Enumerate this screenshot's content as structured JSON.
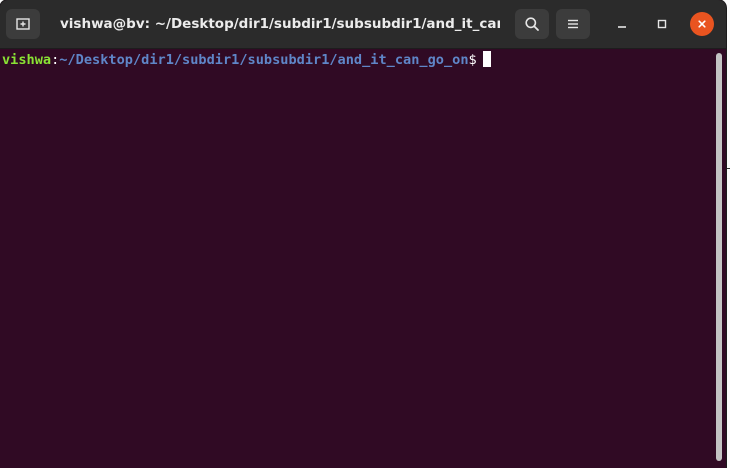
{
  "window": {
    "title": "vishwa@bv: ~/Desktop/dir1/subdir1/subsubdir1/and_it_can_…"
  },
  "headerbar": {
    "new_tab_icon": "new-tab-icon",
    "search_icon": "search-icon",
    "menu_icon": "hamburger-menu-icon",
    "minimize_icon": "minimize-icon",
    "maximize_icon": "maximize-icon",
    "close_icon": "close-icon"
  },
  "terminal": {
    "user": "vishwa",
    "colon": ":",
    "path": "~/Desktop/dir1/subdir1/subsubdir1/and_it_can_go_on",
    "dollar": "$"
  },
  "colors": {
    "terminal_bg": "#300a24",
    "headerbar_bg": "#2b2b2b",
    "prompt_user": "#8ae234",
    "prompt_path": "#5f86c8",
    "close_button": "#e95420"
  }
}
